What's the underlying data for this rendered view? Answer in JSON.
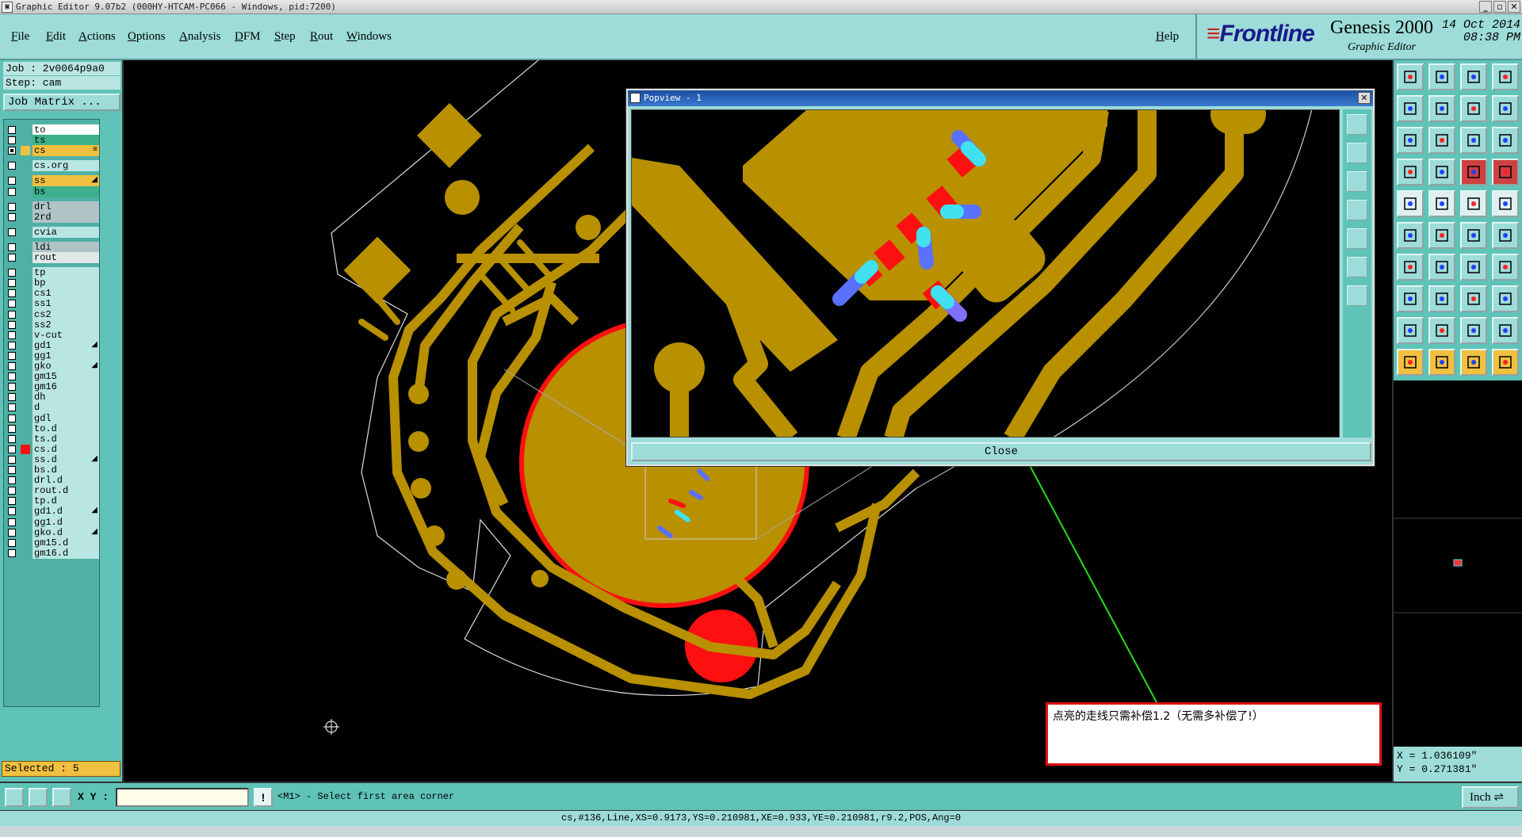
{
  "window": {
    "title": "Graphic Editor 9.07b2 (000HY-HTCAM-PC066 - Windows, pid:7200)"
  },
  "menu": [
    "File",
    "Edit",
    "Actions",
    "Options",
    "Analysis",
    "DFM",
    "Step",
    "Rout",
    "Windows"
  ],
  "help_label": "Help",
  "brand": {
    "logo": "Frontline",
    "product": "Genesis 2000",
    "subtitle": "Graphic Editor",
    "date": "14 Oct 2014",
    "time": "08:38 PM"
  },
  "job": {
    "job_label": "Job : 2v0064p9a0",
    "step_label": "Step: cam",
    "matrix_button": "Job Matrix ..."
  },
  "layers": [
    {
      "name": "to",
      "color": "#ffffff"
    },
    {
      "name": "ts",
      "color": "#3cb08a"
    },
    {
      "name": "cs",
      "color": "#f0c040",
      "selected": true,
      "polarity": "≡"
    },
    {
      "name": "cs.org",
      "color": "#b9e6e2"
    },
    {
      "name": "ss",
      "color": "#f0c040",
      "polarity": "◢"
    },
    {
      "name": "bs",
      "color": "#3cb08a"
    },
    {
      "name": "drl",
      "color": "#b0c4c8"
    },
    {
      "name": "2rd",
      "color": "#b0c4c8"
    },
    {
      "name": "cvia",
      "color": "#b9e6e2"
    },
    {
      "name": "ldi",
      "color": "#b0c4c8"
    },
    {
      "name": "rout",
      "color": "#e0e8e8"
    },
    {
      "name": "tp",
      "color": "#b9e6e2"
    },
    {
      "name": "bp",
      "color": "#b9e6e2"
    },
    {
      "name": "cs1",
      "color": "#b9e6e2"
    },
    {
      "name": "ss1",
      "color": "#b9e6e2"
    },
    {
      "name": "cs2",
      "color": "#b9e6e2"
    },
    {
      "name": "ss2",
      "color": "#b9e6e2"
    },
    {
      "name": "v-cut",
      "color": "#b9e6e2"
    },
    {
      "name": "gd1",
      "color": "#b9e6e2",
      "polarity": "◢"
    },
    {
      "name": "gg1",
      "color": "#b9e6e2"
    },
    {
      "name": "gko",
      "color": "#b9e6e2",
      "polarity": "◢"
    },
    {
      "name": "gm15",
      "color": "#b9e6e2"
    },
    {
      "name": "gm16",
      "color": "#b9e6e2"
    },
    {
      "name": "dh",
      "color": "#b9e6e2"
    },
    {
      "name": "d",
      "color": "#b9e6e2"
    },
    {
      "name": "gdl",
      "color": "#b9e6e2"
    },
    {
      "name": "to.d",
      "color": "#b9e6e2"
    },
    {
      "name": "ts.d",
      "color": "#b9e6e2"
    },
    {
      "name": "cs.d",
      "color": "#b9e6e2",
      "marked": true
    },
    {
      "name": "ss.d",
      "color": "#b9e6e2",
      "polarity": "◢"
    },
    {
      "name": "bs.d",
      "color": "#b9e6e2"
    },
    {
      "name": "drl.d",
      "color": "#b9e6e2"
    },
    {
      "name": "rout.d",
      "color": "#b9e6e2"
    },
    {
      "name": "tp.d",
      "color": "#b9e6e2"
    },
    {
      "name": "gd1.d",
      "color": "#b9e6e2",
      "polarity": "◢"
    },
    {
      "name": "gg1.d",
      "color": "#b9e6e2"
    },
    {
      "name": "gko.d",
      "color": "#b9e6e2",
      "polarity": "◢"
    },
    {
      "name": "gm15.d",
      "color": "#b9e6e2"
    },
    {
      "name": "gm16.d",
      "color": "#b9e6e2"
    }
  ],
  "selected_label": "Selected : 5",
  "popview": {
    "title": "Popview - 1",
    "close_label": "Close"
  },
  "note": "点亮的走线只需补偿1.2（无需多补偿了!）",
  "coords": {
    "x": "X = 1.036109\"",
    "y": "Y = 0.271381\""
  },
  "input": {
    "xy_label": "X Y :",
    "xy_value": "",
    "prompt": "<M1> - Select first area corner",
    "unit": "Inch"
  },
  "status": "cs,#136,Line,XS=0.9173,YS=0.210981,XE=0.933,YE=0.210981,r9.2,POS,Ang=0",
  "colors": {
    "copper": "#b89000",
    "highlight": "#ff1010",
    "cyan": "#40e0f0",
    "blue": "#5a70ff",
    "panel": "#9ddcd8",
    "panel_dark": "#5fc3b8"
  }
}
